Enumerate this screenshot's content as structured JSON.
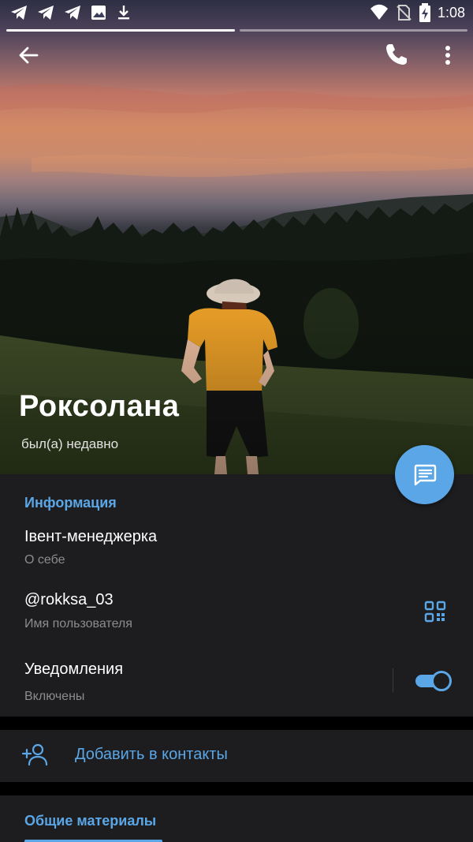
{
  "status_bar": {
    "time": "1:08",
    "left_icons": [
      "telegram-icon",
      "telegram-icon",
      "telegram-icon",
      "image-icon",
      "download-icon"
    ],
    "right_icons": [
      "wifi-icon",
      "no-sim-icon",
      "battery-charging-icon"
    ]
  },
  "profile": {
    "name": "Роксолана",
    "status": "был(а) недавно"
  },
  "info": {
    "section_title": "Информация",
    "bio": "Івент-менеджерка",
    "bio_label": "О себе",
    "username": "@rokksa_03",
    "username_label": "Имя пользователя",
    "notifications": "Уведомления",
    "notifications_state": "Включены",
    "notifications_enabled": true
  },
  "actions": {
    "add_contact": "Добавить в контакты"
  },
  "shared": {
    "title": "Общие материалы"
  },
  "colors": {
    "accent": "#5ba6e6",
    "panel": "#1d1d1f",
    "secondary_text": "#8c8c8e"
  }
}
